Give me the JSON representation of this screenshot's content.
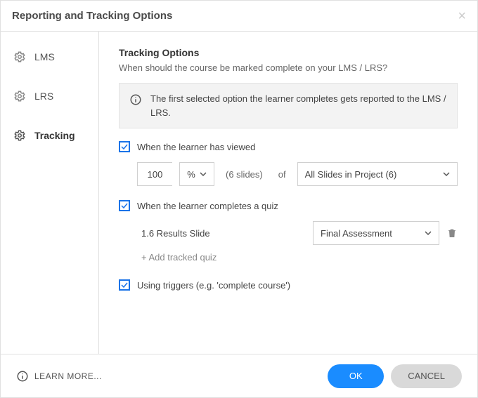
{
  "title": "Reporting and Tracking Options",
  "sidebar": {
    "items": [
      {
        "label": "LMS"
      },
      {
        "label": "LRS"
      },
      {
        "label": "Tracking"
      }
    ]
  },
  "main": {
    "heading": "Tracking Options",
    "sub": "When should the course be marked complete on your LMS / LRS?",
    "info": "The first selected option the learner completes gets reported to the LMS / LRS.",
    "opt_viewed": {
      "label": "When the learner has viewed",
      "value": "100",
      "unit": "%",
      "count_note": "(6 slides)",
      "of": "of",
      "scope": "All Slides in Project (6)"
    },
    "opt_quiz": {
      "label": "When the learner completes a quiz",
      "quiz_title": "1.6 Results Slide",
      "quiz_select": "Final Assessment",
      "add_label": "+ Add tracked quiz"
    },
    "opt_trigger": {
      "label": "Using triggers (e.g. 'complete course')"
    }
  },
  "footer": {
    "learn": "LEARN MORE...",
    "ok": "OK",
    "cancel": "CANCEL"
  }
}
